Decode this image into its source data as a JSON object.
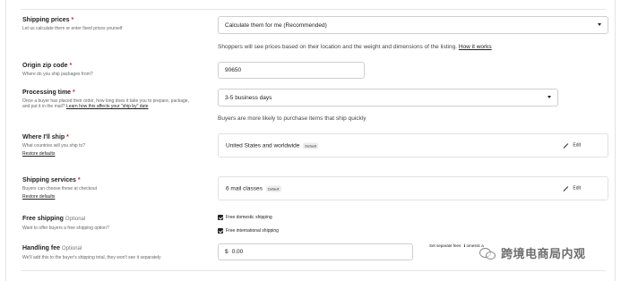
{
  "shipping_prices": {
    "title": "Shipping prices",
    "required_mark": "*",
    "desc": "Let us calculate them or enter fixed prices yourself",
    "select_value": "Calculate them for me (Recommended)",
    "note_text": "Shoppers will see prices based on their location and the weight and dimensions of the listing.",
    "note_link": "How it works"
  },
  "origin_zip": {
    "title": "Origin zip code",
    "required_mark": "*",
    "desc": "Where do you ship packages from?",
    "value": "90650"
  },
  "processing_time": {
    "title": "Processing time",
    "required_mark": "*",
    "desc": "Once a buyer has placed their order, how long does it take you to prepare, package, and put it in the mail?",
    "desc_link": "Learn how this affects your \"ship by\" date",
    "select_value": "3-5 business days",
    "note": "Buyers are more likely to purchase items that ship quickly"
  },
  "where_ship": {
    "title": "Where I'll ship",
    "required_mark": "*",
    "desc": "What countries will you ship to?",
    "restore": "Restore defaults",
    "value": "United States and worldwide",
    "badge": "Default",
    "edit": "Edit"
  },
  "shipping_services": {
    "title": "Shipping services",
    "required_mark": "*",
    "desc": "Buyers can choose these at checkout",
    "restore": "Restore defaults",
    "value": "6 mail classes",
    "badge": "Default",
    "edit": "Edit"
  },
  "free_shipping": {
    "title": "Free shipping",
    "optional": "Optional",
    "desc": "Want to offer buyers a free shipping option?",
    "option_domestic": "Free domestic shipping",
    "option_international": "Free international shipping",
    "domestic_checked": true,
    "international_checked": true
  },
  "handling_fee": {
    "title": "Handling fee",
    "optional": "Optional",
    "desc": "We'll add this to the buyer's shipping total, they won't see it separately",
    "currency": "$",
    "value": "0.00",
    "separate_fees": "Set separate fees",
    "separate_fees_suffix": "ℹ  omestic a"
  },
  "watermark": {
    "text": "跨境电商局内观"
  },
  "colors": {
    "required": "#c82d2d",
    "border": "#cfcfcf",
    "text": "#222222"
  }
}
